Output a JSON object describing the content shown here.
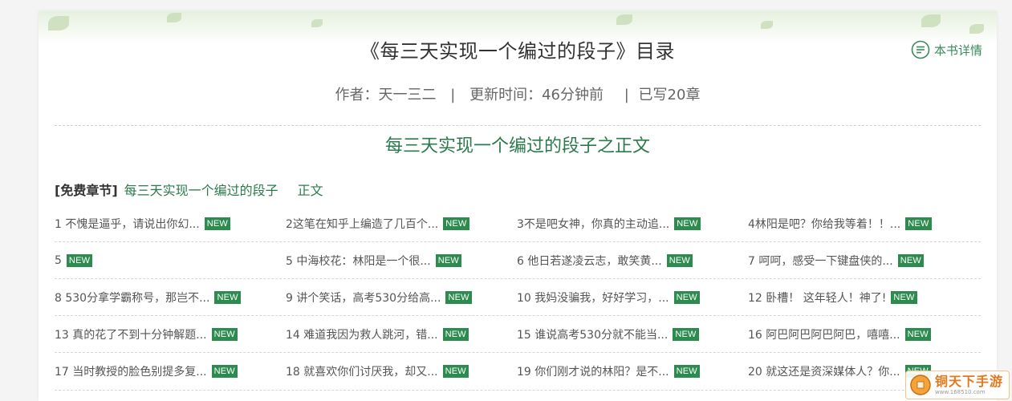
{
  "header": {
    "book_title": "《每三天实现一个编过的段子》目录",
    "detail_link": "本书详情",
    "author": "作者：天一三二",
    "updated": "更新时间：46分钟前",
    "chapters_written": "已写20章",
    "separator": "|"
  },
  "volume": {
    "title": "每三天实现一个编过的段子之正文"
  },
  "crumb": {
    "free_label": "[免费章节]",
    "book_link": "每三天实现一个编过的段子",
    "volume_link": "正文"
  },
  "badge": "NEW",
  "chapter_rows": [
    [
      "1 不愧是逼乎，请说出你幻...",
      "2这笔在知乎上编造了几百个...",
      "3不是吧女神，你真的主动追...",
      "4林阳是吧？你给我等着！！..."
    ],
    [
      "5",
      "5 中海校花：林阳是一个很...",
      "6 他日若遂凌云志，敢笑黄...",
      "7 呵呵，感受一下键盘侠的..."
    ],
    [
      "8 530分拿学霸称号，那岂不...",
      "9 讲个笑话，高考530分给高...",
      "10 我妈没骗我，好好学习，...",
      "12 卧槽！ 这年轻人！神了!"
    ],
    [
      "13 真的花了不到十分钟解题...",
      "14 难道我因为救人跳河，错...",
      "15 谁说高考530分就不能当...",
      "16 阿巴阿巴阿巴阿巴，嘻嘻..."
    ],
    [
      "17 当时教授的脸色别提多复...",
      "18 就喜欢你们讨厌我，却又...",
      "19 你们刚才说的林阳？是不...",
      "20 就这还是资深媒体人？你..."
    ]
  ],
  "watermark": {
    "brand": "铜天下手游",
    "url": "www.168510.com"
  },
  "colors": {
    "accent_green": "#2b7a4b",
    "badge_green": "#2e8b4f",
    "watermark_orange": "#e2781b"
  },
  "icons": {
    "detail": "list-circle-icon",
    "watermark_logo": "coin-logo-icon"
  }
}
